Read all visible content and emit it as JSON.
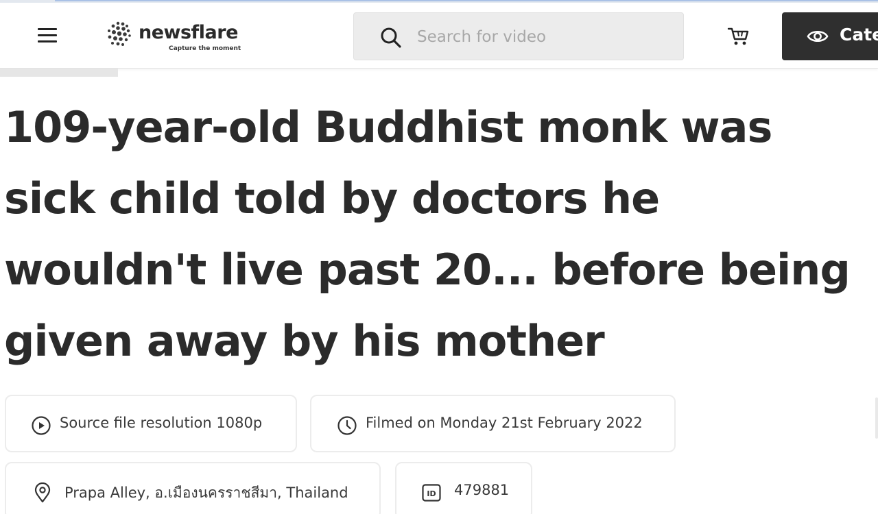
{
  "header": {
    "menu_icon": "hamburger-menu-icon",
    "logo": {
      "name": "newsflare",
      "tagline": "Capture the moment"
    },
    "search": {
      "placeholder": "Search for video",
      "value": "",
      "icon": "search-icon"
    },
    "cart_icon": "cart-icon",
    "categories_button": {
      "label": "Categ",
      "icon": "eye-icon",
      "bg_color": "#2f2f2f"
    }
  },
  "article": {
    "title": "109-year-old Buddhist monk was sick child told by doctors he wouldn't live past 20... before being given away by his mother"
  },
  "meta": {
    "resolution": {
      "icon": "play-circle-icon",
      "text": "Source file resolution 1080p"
    },
    "filmed": {
      "icon": "clock-icon",
      "text": "Filmed on Monday 21st February 2022"
    },
    "location": {
      "icon": "location-pin-icon",
      "text": "Prapa Alley, อ.เมืองนครราชสีมา, Thailand"
    },
    "id": {
      "icon": "id-badge-icon",
      "text": "479881"
    }
  }
}
